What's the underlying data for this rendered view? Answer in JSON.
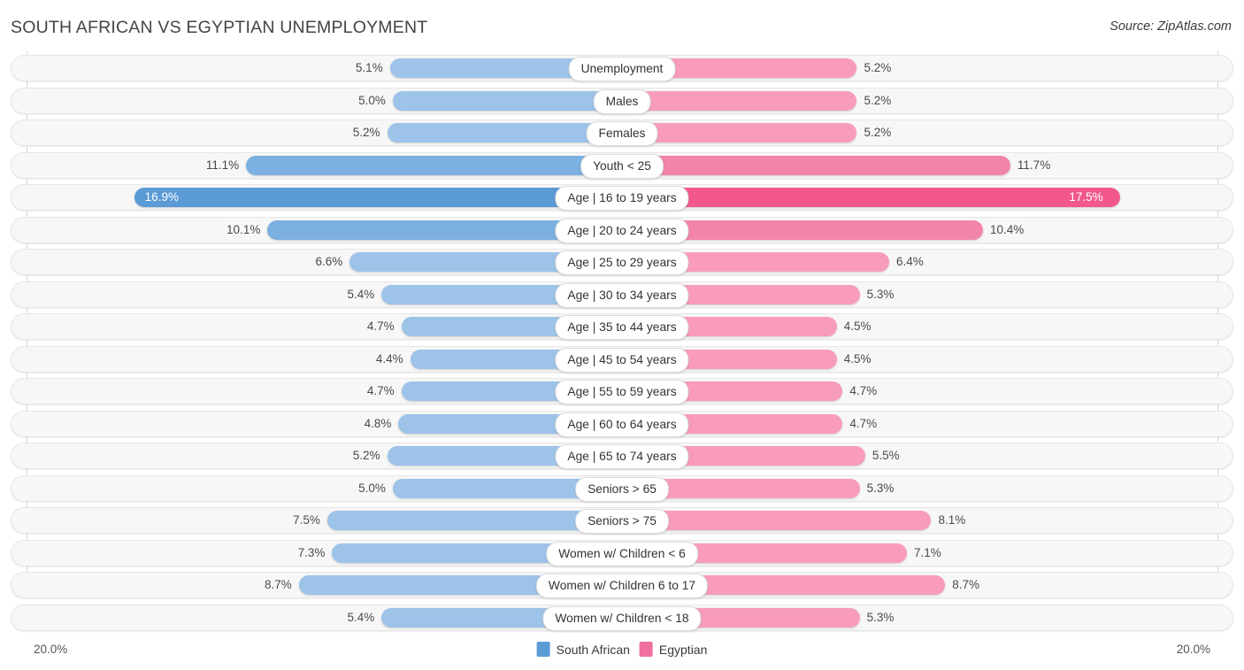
{
  "header": {
    "title": "SOUTH AFRICAN VS EGYPTIAN UNEMPLOYMENT",
    "source": "Source: ZipAtlas.com"
  },
  "legend": {
    "left_label": "South African",
    "right_label": "Egyptian",
    "left_color": "#5b9bd5",
    "right_color": "#ef6f9e"
  },
  "axis": {
    "left_max_label": "20.0%",
    "right_max_label": "20.0%",
    "max_value": 20.0
  },
  "colors": {
    "blue_light": "#9dc3e9",
    "blue_mid": "#7cb0e1",
    "blue_strong": "#5b9bd5",
    "pink_light": "#f99cbc",
    "pink_mid": "#f284ab",
    "pink_strong": "#f2588e",
    "track_bg": "#f7f7f7",
    "track_border": "#e6e6e6",
    "gridline": "#d7d7d7"
  },
  "chart_data": {
    "type": "bar",
    "orientation": "horizontal-diverging",
    "title": "SOUTH AFRICAN VS EGYPTIAN UNEMPLOYMENT",
    "xlabel": "",
    "ylabel": "",
    "xlim": [
      20.0,
      20.0
    ],
    "grid": true,
    "legend_position": "bottom-center",
    "series": [
      {
        "name": "South African",
        "side": "left",
        "color": "#9dc3e9",
        "values": [
          5.1,
          5.0,
          5.2,
          11.1,
          16.9,
          10.1,
          6.6,
          5.4,
          4.7,
          4.4,
          4.7,
          4.8,
          5.2,
          5.0,
          7.5,
          7.3,
          8.7,
          5.4
        ]
      },
      {
        "name": "Egyptian",
        "side": "right",
        "color": "#f99cbc",
        "values": [
          5.2,
          5.2,
          5.2,
          11.7,
          17.5,
          10.4,
          6.4,
          5.3,
          4.5,
          4.5,
          4.7,
          4.7,
          5.5,
          5.3,
          8.1,
          7.1,
          8.7,
          5.3
        ]
      }
    ],
    "categories": [
      "Unemployment",
      "Males",
      "Females",
      "Youth < 25",
      "Age | 16 to 19 years",
      "Age | 20 to 24 years",
      "Age | 25 to 29 years",
      "Age | 30 to 34 years",
      "Age | 35 to 44 years",
      "Age | 45 to 54 years",
      "Age | 55 to 59 years",
      "Age | 60 to 64 years",
      "Age | 65 to 74 years",
      "Seniors > 65",
      "Seniors > 75",
      "Women w/ Children < 6",
      "Women w/ Children 6 to 17",
      "Women w/ Children < 18"
    ]
  },
  "rows": [
    {
      "label": "Unemployment",
      "left_value": 5.1,
      "right_value": 5.2,
      "left_text": "5.1%",
      "right_text": "5.2%",
      "emphasis": "low"
    },
    {
      "label": "Males",
      "left_value": 5.0,
      "right_value": 5.2,
      "left_text": "5.0%",
      "right_text": "5.2%",
      "emphasis": "low"
    },
    {
      "label": "Females",
      "left_value": 5.2,
      "right_value": 5.2,
      "left_text": "5.2%",
      "right_text": "5.2%",
      "emphasis": "low"
    },
    {
      "label": "Youth < 25",
      "left_value": 11.1,
      "right_value": 11.7,
      "left_text": "11.1%",
      "right_text": "11.7%",
      "emphasis": "mid"
    },
    {
      "label": "Age | 16 to 19 years",
      "left_value": 16.9,
      "right_value": 17.5,
      "left_text": "16.9%",
      "right_text": "17.5%",
      "emphasis": "high"
    },
    {
      "label": "Age | 20 to 24 years",
      "left_value": 10.1,
      "right_value": 10.4,
      "left_text": "10.1%",
      "right_text": "10.4%",
      "emphasis": "mid"
    },
    {
      "label": "Age | 25 to 29 years",
      "left_value": 6.6,
      "right_value": 6.4,
      "left_text": "6.6%",
      "right_text": "6.4%",
      "emphasis": "low"
    },
    {
      "label": "Age | 30 to 34 years",
      "left_value": 5.4,
      "right_value": 5.3,
      "left_text": "5.4%",
      "right_text": "5.3%",
      "emphasis": "low"
    },
    {
      "label": "Age | 35 to 44 years",
      "left_value": 4.7,
      "right_value": 4.5,
      "left_text": "4.7%",
      "right_text": "4.5%",
      "emphasis": "low"
    },
    {
      "label": "Age | 45 to 54 years",
      "left_value": 4.4,
      "right_value": 4.5,
      "left_text": "4.4%",
      "right_text": "4.5%",
      "emphasis": "low"
    },
    {
      "label": "Age | 55 to 59 years",
      "left_value": 4.7,
      "right_value": 4.7,
      "left_text": "4.7%",
      "right_text": "4.7%",
      "emphasis": "low"
    },
    {
      "label": "Age | 60 to 64 years",
      "left_value": 4.8,
      "right_value": 4.7,
      "left_text": "4.8%",
      "right_text": "4.7%",
      "emphasis": "low"
    },
    {
      "label": "Age | 65 to 74 years",
      "left_value": 5.2,
      "right_value": 5.5,
      "left_text": "5.2%",
      "right_text": "5.5%",
      "emphasis": "low"
    },
    {
      "label": "Seniors > 65",
      "left_value": 5.0,
      "right_value": 5.3,
      "left_text": "5.0%",
      "right_text": "5.3%",
      "emphasis": "low"
    },
    {
      "label": "Seniors > 75",
      "left_value": 7.5,
      "right_value": 8.1,
      "left_text": "7.5%",
      "right_text": "8.1%",
      "emphasis": "low"
    },
    {
      "label": "Women w/ Children < 6",
      "left_value": 7.3,
      "right_value": 7.1,
      "left_text": "7.3%",
      "right_text": "7.1%",
      "emphasis": "low"
    },
    {
      "label": "Women w/ Children 6 to 17",
      "left_value": 8.7,
      "right_value": 8.7,
      "left_text": "8.7%",
      "right_text": "8.7%",
      "emphasis": "low"
    },
    {
      "label": "Women w/ Children < 18",
      "left_value": 5.4,
      "right_value": 5.3,
      "left_text": "5.4%",
      "right_text": "5.3%",
      "emphasis": "low"
    }
  ]
}
